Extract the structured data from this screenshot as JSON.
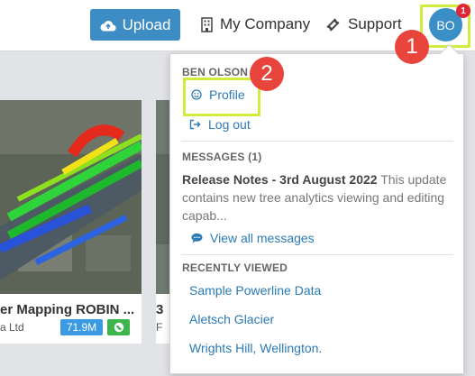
{
  "header": {
    "upload_label": "Upload",
    "company_label": "My Company",
    "support_label": "Support",
    "avatar_initials": "BO",
    "notification_count": "1"
  },
  "steps": [
    "1",
    "2"
  ],
  "cards": [
    {
      "title": "er Mapping ROBIN ...",
      "subtitle": "a Ltd",
      "size": "71.9M"
    },
    {
      "title": "3",
      "subtitle": "F"
    }
  ],
  "dropdown": {
    "user_name": "BEN OLSON",
    "profile_label": "Profile",
    "logout_label": "Log out",
    "messages_header": "MESSAGES (1)",
    "message_title": "Release Notes - 3rd August 2022",
    "message_preview": "This update contains new tree analytics viewing and editing capab...",
    "view_all_label": "View all messages",
    "recent_header": "RECENTLY VIEWED",
    "recent_items": [
      "Sample Powerline Data",
      "Aletsch Glacier",
      "Wrights Hill, Wellington."
    ]
  },
  "colors": {
    "brand_blue": "#3d8cc4",
    "link_blue": "#2c7bb6",
    "highlight": "#d3ea3f",
    "step_red": "#e9443c"
  }
}
